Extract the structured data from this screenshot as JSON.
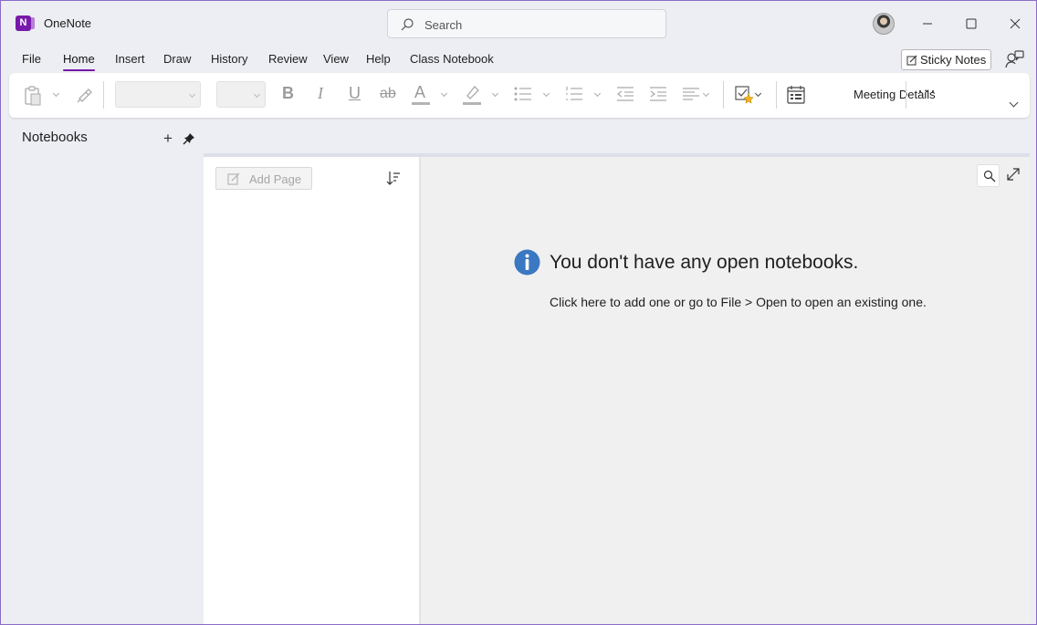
{
  "app": {
    "title": "OneNote",
    "logo_letter": "N",
    "accent_color": "#7719aa"
  },
  "search": {
    "placeholder": "Search"
  },
  "menu": {
    "items": [
      "File",
      "Home",
      "Insert",
      "Draw",
      "History",
      "Review",
      "View",
      "Help",
      "Class Notebook"
    ],
    "active": "Home",
    "sticky_notes_label": "Sticky Notes"
  },
  "ribbon": {
    "bold": "B",
    "italic": "I",
    "underline": "U",
    "strikethrough": "ab",
    "font_color": "A",
    "meeting_details_label": "Meeting Details",
    "more": "···"
  },
  "navigation": {
    "title": "Notebooks",
    "add": "+"
  },
  "pages": {
    "add_page_label": "Add Page"
  },
  "empty_state": {
    "title": "You don't have any open notebooks.",
    "hint": "Click here to add one or go to File > Open to open an existing one."
  },
  "icons": [
    "search-icon",
    "avatar",
    "minimize-icon",
    "maximize-icon",
    "close-icon",
    "sticky-note-icon",
    "feedback-icon",
    "clipboard-icon",
    "format-painter-icon",
    "highlighter-icon",
    "bullets-icon",
    "numbering-icon",
    "outdent-icon",
    "indent-icon",
    "align-icon",
    "tag-icon",
    "meeting-icon",
    "pin-icon",
    "sort-icon",
    "expand-icon",
    "info-icon"
  ]
}
